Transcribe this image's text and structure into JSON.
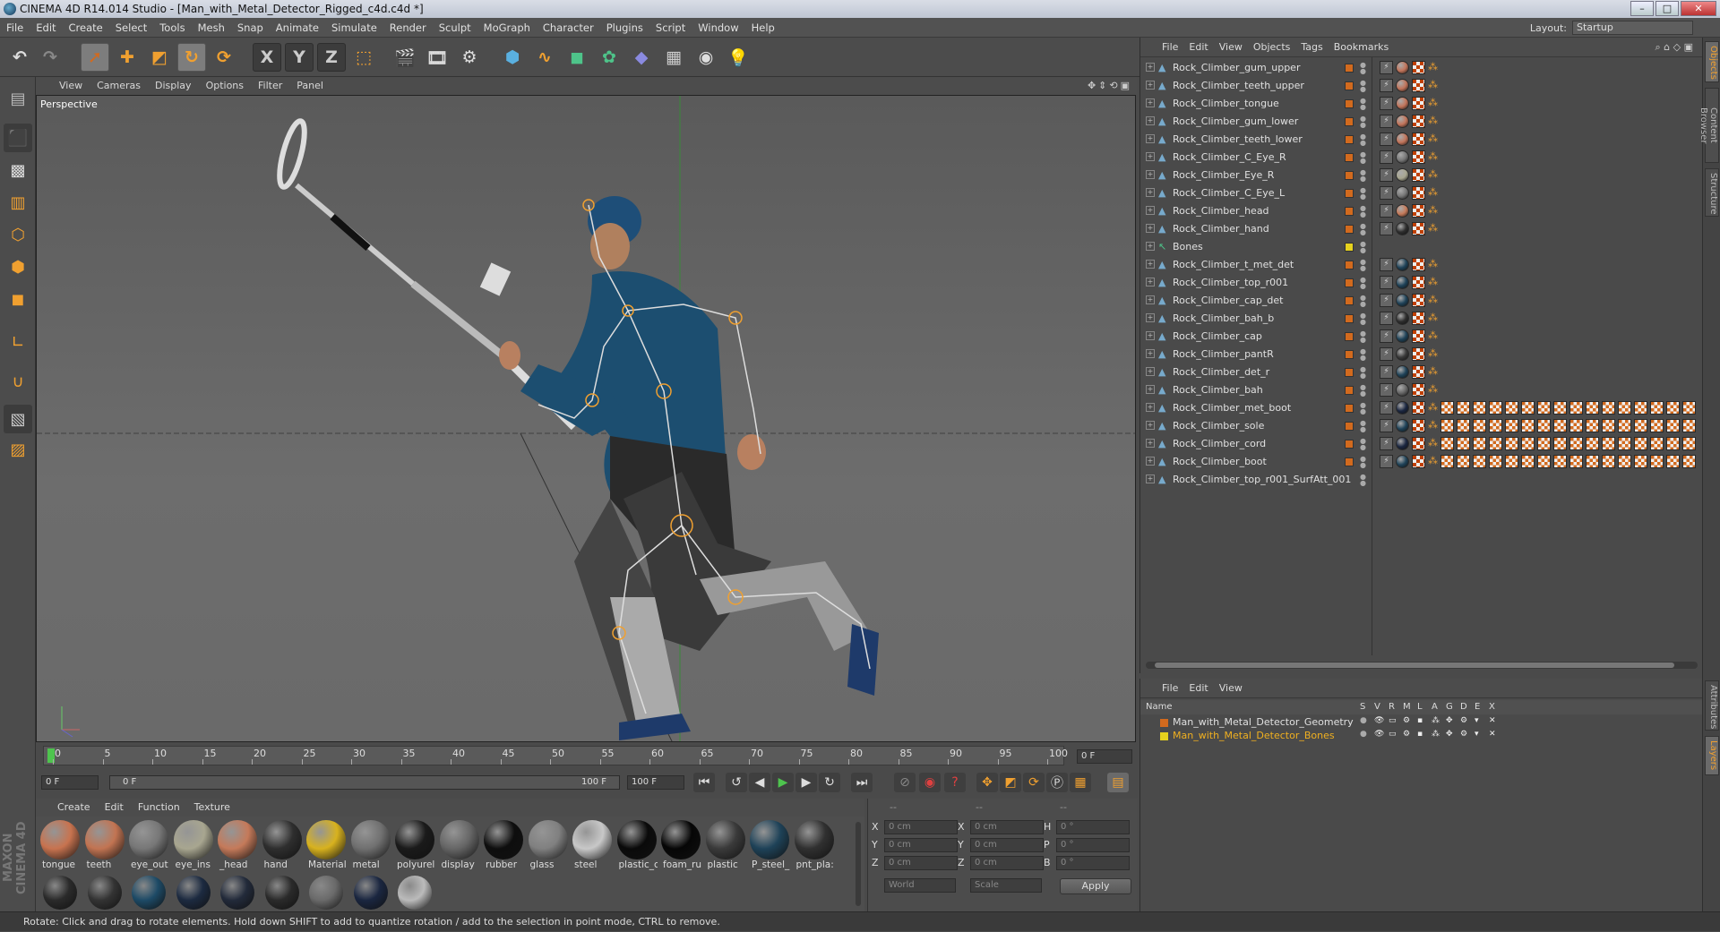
{
  "window": {
    "title": "CINEMA 4D R14.014 Studio - [Man_with_Metal_Detector_Rigged_c4d.c4d *]",
    "layout_label": "Layout:",
    "layout_value": "Startup"
  },
  "menu": [
    "File",
    "Edit",
    "Create",
    "Select",
    "Tools",
    "Mesh",
    "Snap",
    "Animate",
    "Simulate",
    "Render",
    "Sculpt",
    "MoGraph",
    "Character",
    "Plugins",
    "Script",
    "Window",
    "Help"
  ],
  "toolbar": {
    "undo": "undo-icon",
    "redo": "redo-icon",
    "select": "select-arrow-icon",
    "move": "move-icon",
    "scale": "scale-icon",
    "rotate": "rotate-icon",
    "recent": "recent-tool-icon",
    "x_axis": "X",
    "y_axis": "Y",
    "z_axis": "Z",
    "coord": "world-coordinate-icon",
    "render_view": "render-view-icon",
    "render_picture": "render-picture-viewer-icon",
    "render_settings": "render-settings-icon",
    "cube": "cube-icon",
    "spline": "spline-icon",
    "nurbs": "nurbs-icon",
    "array": "array-icon",
    "deformer": "deformer-icon",
    "floor": "floor-icon",
    "camera": "camera-icon",
    "light": "light-icon"
  },
  "viewport": {
    "menu": [
      "View",
      "Cameras",
      "Display",
      "Options",
      "Filter",
      "Panel"
    ],
    "label": "Perspective"
  },
  "timeline": {
    "ticks": [
      "0",
      "5",
      "10",
      "15",
      "20",
      "25",
      "30",
      "35",
      "40",
      "45",
      "50",
      "55",
      "60",
      "65",
      "70",
      "75",
      "80",
      "85",
      "90",
      "95",
      "100"
    ],
    "current_frame": "0 F"
  },
  "transport": {
    "start_field": "0 F",
    "range_start": "0 F",
    "range_end": "100 F",
    "end_field": "100 F"
  },
  "material_manager": {
    "menu": [
      "Create",
      "Edit",
      "Function",
      "Texture"
    ],
    "materials": [
      {
        "name": "tongue",
        "color": "#c8734f"
      },
      {
        "name": "teeth",
        "color": "#c27452"
      },
      {
        "name": "eye_out",
        "color": "#777777"
      },
      {
        "name": "eye_ins",
        "color": "#a8a690"
      },
      {
        "name": "_head",
        "color": "#c57a5a"
      },
      {
        "name": "hand",
        "color": "#2e2e2e"
      },
      {
        "name": "Material",
        "color": "#d8b21e"
      },
      {
        "name": "metal",
        "color": "#707070"
      },
      {
        "name": "polyurel",
        "color": "#1a1a1a"
      },
      {
        "name": "display",
        "color": "#666666"
      },
      {
        "name": "rubber",
        "color": "#0e0e0e"
      },
      {
        "name": "glass",
        "color": "#808080"
      },
      {
        "name": "steel",
        "color": "#c8c8c8"
      },
      {
        "name": "plastic_c",
        "color": "#0a0a0a"
      },
      {
        "name": "foam_ru",
        "color": "#060606"
      },
      {
        "name": "plastic",
        "color": "#3a3a3a"
      },
      {
        "name": "P_steel_",
        "color": "#1e4258"
      },
      {
        "name": "pnt_pla:",
        "color": "#303030"
      }
    ],
    "row2_colors": [
      "#2a2a2a",
      "#333333",
      "#1d4a66",
      "#1c2a40",
      "#222a3a",
      "#2a2a2a",
      "#6a6a6a",
      "#1a2640",
      "#bbbbbb"
    ]
  },
  "coordinates": {
    "header": [
      "--",
      "--",
      "--"
    ],
    "rows": [
      {
        "a": "X",
        "av": "0 cm",
        "b": "X",
        "bv": "0 cm",
        "c": "H",
        "cv": "0 °"
      },
      {
        "a": "Y",
        "av": "0 cm",
        "b": "Y",
        "bv": "0 cm",
        "c": "P",
        "cv": "0 °"
      },
      {
        "a": "Z",
        "av": "0 cm",
        "b": "Z",
        "bv": "0 cm",
        "c": "B",
        "cv": "0 °"
      }
    ],
    "mode1": "World",
    "mode2": "Scale",
    "apply": "Apply"
  },
  "object_manager": {
    "menu": [
      "File",
      "Edit",
      "View",
      "Objects",
      "Tags",
      "Bookmarks"
    ],
    "objects": [
      {
        "name": "Rock_Climber_gum_upper",
        "layer": "#d26a1e",
        "tag": "#c2745a",
        "extra": 1
      },
      {
        "name": "Rock_Climber_teeth_upper",
        "layer": "#d26a1e",
        "tag": "#c2745a",
        "extra": 1
      },
      {
        "name": "Rock_Climber_tongue",
        "layer": "#d26a1e",
        "tag": "#c2745a",
        "extra": 1
      },
      {
        "name": "Rock_Climber_gum_lower",
        "layer": "#d26a1e",
        "tag": "#c2745a",
        "extra": 1
      },
      {
        "name": "Rock_Climber_teeth_lower",
        "layer": "#d26a1e",
        "tag": "#c2745a",
        "extra": 1
      },
      {
        "name": "Rock_Climber_C_Eye_R",
        "layer": "#d26a1e",
        "tag": "#777777",
        "extra": 1
      },
      {
        "name": "Rock_Climber_Eye_R",
        "layer": "#d26a1e",
        "tag": "#a8a690",
        "extra": 1
      },
      {
        "name": "Rock_Climber_C_Eye_L",
        "layer": "#d26a1e",
        "tag": "#777777",
        "extra": 1
      },
      {
        "name": "Rock_Climber_head",
        "layer": "#d26a1e",
        "tag": "#c57a5a",
        "extra": 1
      },
      {
        "name": "Rock_Climber_hand",
        "layer": "#d26a1e",
        "tag": "#2e2e2e",
        "extra": 1
      },
      {
        "name": "Bones",
        "layer": "#e6d21e",
        "tag": "",
        "extra": 0
      },
      {
        "name": "Rock_Climber_t_met_det",
        "layer": "#d26a1e",
        "tag": "#1e4258",
        "extra": 1
      },
      {
        "name": "Rock_Climber_top_r001",
        "layer": "#d26a1e",
        "tag": "#1e4258",
        "extra": 1
      },
      {
        "name": "Rock_Climber_cap_det",
        "layer": "#d26a1e",
        "tag": "#1e4258",
        "extra": 1
      },
      {
        "name": "Rock_Climber_bah_b",
        "layer": "#d26a1e",
        "tag": "#2e2e2e",
        "extra": 1
      },
      {
        "name": "Rock_Climber_cap",
        "layer": "#d26a1e",
        "tag": "#1e4258",
        "extra": 1
      },
      {
        "name": "Rock_Climber_pantR",
        "layer": "#d26a1e",
        "tag": "#3a3a3a",
        "extra": 1
      },
      {
        "name": "Rock_Climber_det_r",
        "layer": "#d26a1e",
        "tag": "#1e4258",
        "extra": 1
      },
      {
        "name": "Rock_Climber_bah",
        "layer": "#d26a1e",
        "tag": "#666666",
        "extra": 1
      },
      {
        "name": "Rock_Climber_met_boot",
        "layer": "#d26a1e",
        "tag": "#1a2640",
        "extra": 2
      },
      {
        "name": "Rock_Climber_sole",
        "layer": "#d26a1e",
        "tag": "#1e4258",
        "extra": 2
      },
      {
        "name": "Rock_Climber_cord",
        "layer": "#d26a1e",
        "tag": "#1a2640",
        "extra": 2
      },
      {
        "name": "Rock_Climber_boot",
        "layer": "#d26a1e",
        "tag": "#1e4258",
        "extra": 2
      },
      {
        "name": "Rock_Climber_top_r001_SurfAtt_001",
        "layer": "",
        "tag": "",
        "extra": 0
      }
    ]
  },
  "layer_manager": {
    "menu": [
      "File",
      "Edit",
      "View"
    ],
    "header": {
      "name": "Name",
      "cols": [
        "S",
        "V",
        "R",
        "M",
        "L",
        "A",
        "G",
        "D",
        "E",
        "X"
      ]
    },
    "layers": [
      {
        "name": "Man_with_Metal_Detector_Geometry",
        "color": "#d26a1e",
        "text_color": "#e0e0e0"
      },
      {
        "name": "Man_with_Metal_Detector_Bones",
        "color": "#e6d21e",
        "text_color": "#f0b020"
      }
    ]
  },
  "side_tabs": [
    "Objects",
    "Content Browser",
    "Structure",
    "Attributes",
    "Layers"
  ],
  "status": "Rotate: Click and drag to rotate elements. Hold down SHIFT to add to quantize rotation / add to the selection in point mode, CTRL to remove.",
  "branding": "MAXON CINEMA 4D"
}
